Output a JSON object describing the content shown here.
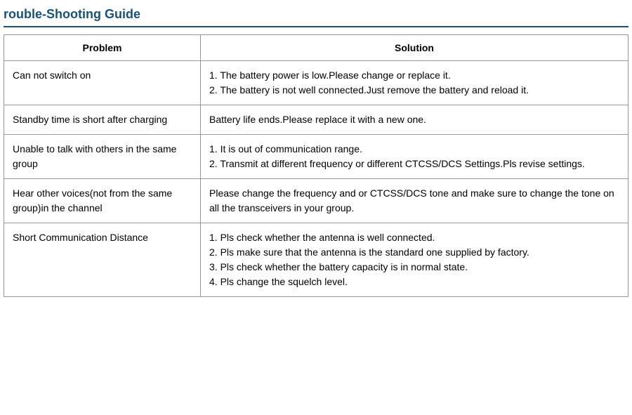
{
  "page": {
    "title": "rouble-Shooting Guide"
  },
  "table": {
    "header": {
      "problem": "Problem",
      "solution": "Solution"
    },
    "rows": [
      {
        "problem": "Can not switch on",
        "solution": "1. The battery power is low.Please change or replace it.\n2. The battery is not well connected.Just remove the battery and reload it."
      },
      {
        "problem": "Standby time is short after charging",
        "solution": "Battery life ends.Please replace it with a new one."
      },
      {
        "problem": "Unable to talk with others in the same group",
        "solution": "1. It is out of communication range.\n2. Transmit at different frequency or different CTCSS/DCS Settings.Pls revise settings."
      },
      {
        "problem": "Hear other voices(not from the same group)in the channel",
        "solution": "Please change the frequency and or CTCSS/DCS tone and make sure to change the tone on all the transceivers in your group."
      },
      {
        "problem": "Short Communication Distance",
        "solution": "1. Pls check whether the antenna is well connected.\n2. Pls make sure that the antenna is the standard one supplied by factory.\n3. Pls check whether the battery capacity is in normal state.\n4. Pls change the squelch level."
      }
    ]
  }
}
